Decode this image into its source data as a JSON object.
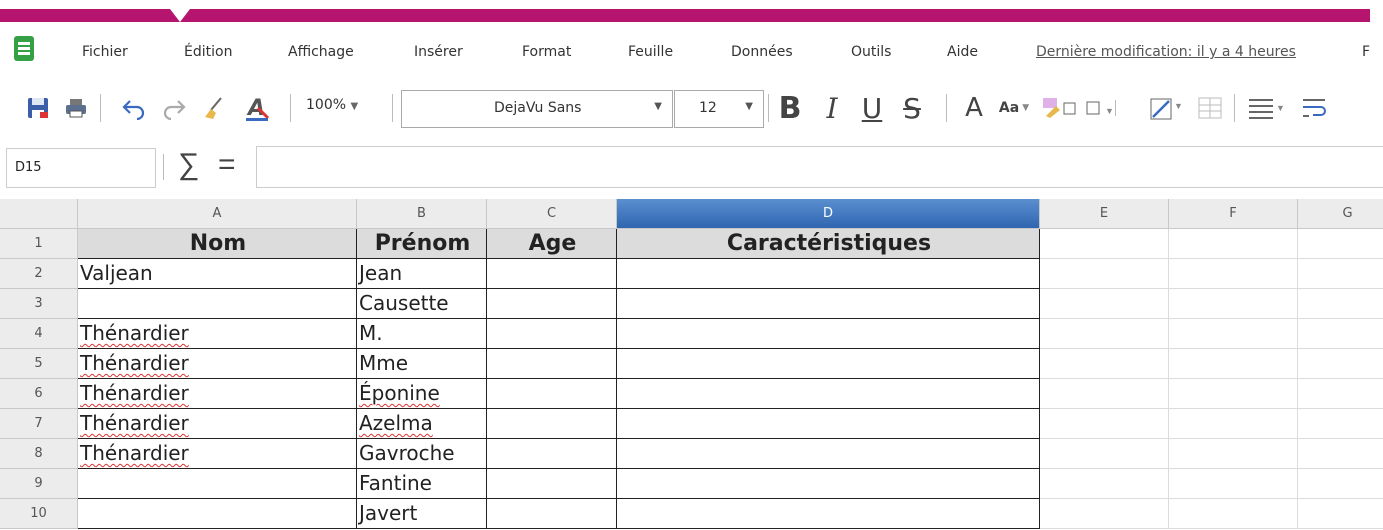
{
  "menu": {
    "items": [
      "Fichier",
      "Édition",
      "Affichage",
      "Insérer",
      "Format",
      "Feuille",
      "Données",
      "Outils",
      "Aide"
    ],
    "last_modified": "Dernière modification: il y a 4 heures",
    "overflow": "F"
  },
  "toolbar": {
    "zoom": "100%",
    "font_name": "DejaVu Sans",
    "font_size": "12",
    "bold": "B",
    "italic": "I",
    "underline": "U",
    "strike": "S",
    "font_color": "A",
    "case_menu": "Aa",
    "icons": [
      "save-icon",
      "print-icon",
      "undo-icon",
      "redo-icon",
      "clear-format-icon",
      "paint-format-icon",
      "bold-icon",
      "italic-icon",
      "underline-icon",
      "strikethrough-icon",
      "font-color-icon",
      "change-case-icon",
      "highlight-icon",
      "borders-icon",
      "border-color-icon",
      "merge-cells-icon",
      "align-icon",
      "wrap-icon"
    ]
  },
  "formula": {
    "cell_ref": "D15",
    "sum_symbol": "∑",
    "equals_symbol": "="
  },
  "sheet": {
    "columns": [
      "A",
      "B",
      "C",
      "D",
      "E",
      "F",
      "G"
    ],
    "selected_column": "D",
    "rows": [
      "1",
      "2",
      "3",
      "4",
      "5",
      "6",
      "7",
      "8",
      "9",
      "10"
    ],
    "header": [
      "Nom",
      "Prénom",
      "Age",
      "Caractéristiques"
    ],
    "data": [
      [
        "Valjean",
        "Jean",
        "",
        ""
      ],
      [
        "",
        "Causette",
        "",
        ""
      ],
      [
        "Thénardier",
        "M.",
        "",
        ""
      ],
      [
        "Thénardier",
        "Mme",
        "",
        ""
      ],
      [
        "Thénardier",
        "Éponine",
        "",
        ""
      ],
      [
        "Thénardier",
        "Azelma",
        "",
        ""
      ],
      [
        "Thénardier",
        "Gavroche",
        "",
        ""
      ],
      [
        "",
        "Fantine",
        "",
        ""
      ],
      [
        "",
        "Javert",
        "",
        ""
      ]
    ]
  },
  "colors": {
    "brand_bar": "#b5156f",
    "app_green": "#35a045",
    "selected_header": "#2f66b0"
  }
}
